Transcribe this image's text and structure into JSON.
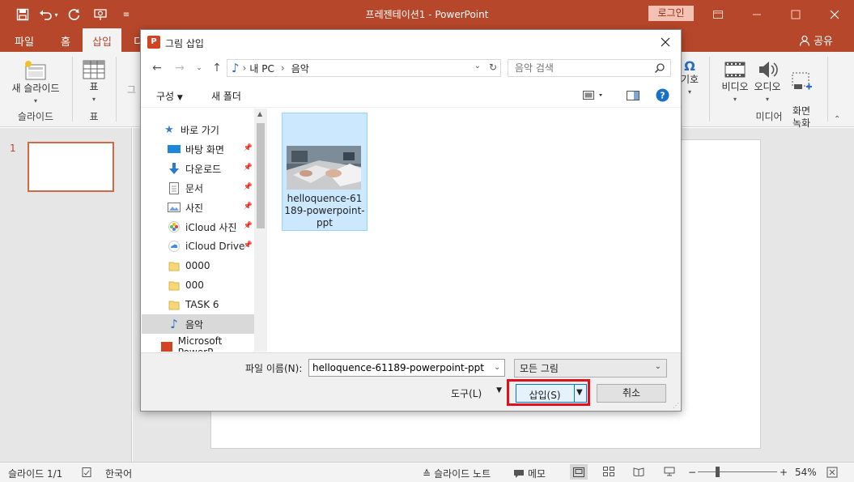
{
  "colors": {
    "accent": "#b7472a",
    "ribbon_bg": "#f3f3f3",
    "selection": "#cce8ff",
    "highlight": "#e0101c"
  },
  "titlebar": {
    "title": "프레젠테이션1  -  PowerPoint",
    "login": "로그인",
    "qat_icons": [
      "save-icon",
      "undo-icon",
      "redo-icon",
      "present-from-start-icon",
      "customize-qat-icon"
    ]
  },
  "tabs": {
    "file": "파일",
    "home": "홈",
    "insert": "삽입",
    "design_partial": "디",
    "share": "공유"
  },
  "ribbon": {
    "new_slide": "새 슬라이드",
    "slides_group": "슬라이드",
    "table": "표",
    "tables_group": "표",
    "partial_left": "그",
    "symbol_partial": "기호",
    "video": "비디오",
    "audio": "오디오",
    "screen_record": "화면\n녹화",
    "media_group": "미디어"
  },
  "thumbnails": {
    "slide_number": "1"
  },
  "statusbar": {
    "slide_counter": "슬라이드 1/1",
    "language": "한국어",
    "notes": "슬라이드 노트",
    "comments": "메모",
    "zoom": "54%"
  },
  "dialog": {
    "title": "그림 삽입",
    "breadcrumb": [
      "내 PC",
      "음악"
    ],
    "search_placeholder": "음악 검색",
    "organize": "구성",
    "new_folder": "새 폴더",
    "nav_items": [
      {
        "label": "바로 가기",
        "icon": "star-icon",
        "pinned": false
      },
      {
        "label": "바탕 화면",
        "icon": "desktop-icon",
        "pinned": true
      },
      {
        "label": "다운로드",
        "icon": "download-icon",
        "pinned": true
      },
      {
        "label": "문서",
        "icon": "document-icon",
        "pinned": true
      },
      {
        "label": "사진",
        "icon": "pictures-icon",
        "pinned": true
      },
      {
        "label": "iCloud 사진",
        "icon": "icloud-photos-icon",
        "pinned": true
      },
      {
        "label": "iCloud Drive",
        "icon": "icloud-drive-icon",
        "pinned": true
      },
      {
        "label": "0000",
        "icon": "folder-icon",
        "pinned": false
      },
      {
        "label": "000",
        "icon": "folder-icon",
        "pinned": false
      },
      {
        "label": "TASK 6",
        "icon": "folder-icon",
        "pinned": false
      },
      {
        "label": "음악",
        "icon": "music-icon",
        "pinned": false,
        "selected": true
      },
      {
        "label": "Microsoft PowerP",
        "icon": "powerpoint-icon",
        "pinned": false
      }
    ],
    "file": {
      "name": "helloquence-61189-powerpoint-ppt"
    },
    "filename_label": "파일 이름(N):",
    "filename_value": "helloquence-61189-powerpoint-ppt",
    "filetype": "모든 그림",
    "tools": "도구(L)",
    "insert": "삽입(S)",
    "cancel": "취소"
  }
}
